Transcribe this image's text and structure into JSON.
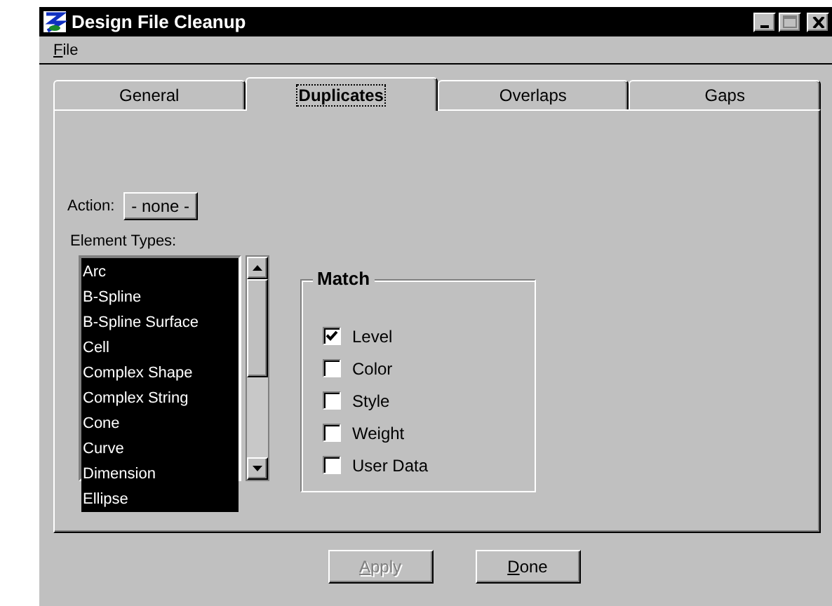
{
  "window": {
    "title": "Design File Cleanup"
  },
  "menu": [
    {
      "label": "File"
    }
  ],
  "tabs": [
    {
      "label": "General",
      "selected": false
    },
    {
      "label": "Duplicates",
      "selected": true
    },
    {
      "label": "Overlaps",
      "selected": false
    },
    {
      "label": "Gaps",
      "selected": false
    }
  ],
  "action": {
    "label": "Action:",
    "value": "- none -"
  },
  "element_types": {
    "label": "Element Types:",
    "items": [
      {
        "label": "Arc",
        "selected": true
      },
      {
        "label": "B-Spline",
        "selected": true
      },
      {
        "label": "B-Spline Surface",
        "selected": true
      },
      {
        "label": "Cell",
        "selected": true
      },
      {
        "label": "Complex Shape",
        "selected": true
      },
      {
        "label": "Complex String",
        "selected": true
      },
      {
        "label": "Cone",
        "selected": true
      },
      {
        "label": "Curve",
        "selected": true
      },
      {
        "label": "Dimension",
        "selected": true
      },
      {
        "label": "Ellipse",
        "selected": true
      }
    ]
  },
  "match": {
    "title": "Match",
    "options": [
      {
        "label": "Level",
        "checked": true
      },
      {
        "label": "Color",
        "checked": false
      },
      {
        "label": "Style",
        "checked": false
      },
      {
        "label": "Weight",
        "checked": false
      },
      {
        "label": "User Data",
        "checked": false
      }
    ]
  },
  "buttons": [
    {
      "label": "Apply",
      "disabled": true
    },
    {
      "label": "Done",
      "disabled": false
    }
  ]
}
